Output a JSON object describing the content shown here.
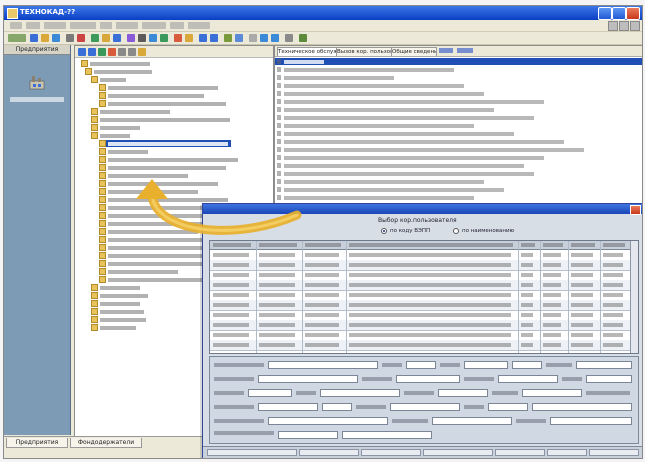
{
  "window": {
    "title": "ТЕХНОКАД-??"
  },
  "sidebar": {
    "header": "Предприятия",
    "item_icon": "plant-icon"
  },
  "bottom_tabs": [
    "Предприятия",
    "Фондодержатели"
  ],
  "docs": {
    "tabs": [
      "Техническое обслуживание",
      "Вызов кор. пользователя",
      "Общие сведения"
    ]
  },
  "dialog": {
    "choose_label": "Выбор кор.пользователя",
    "option_1": "по коду ВЭПП",
    "option_2": "по наименованию"
  },
  "colors": {
    "title_bar": "#0a3fc4",
    "selection": "#1e4fb4",
    "sidebar": "#7e9bb6",
    "arrow": "#e8b02c"
  }
}
